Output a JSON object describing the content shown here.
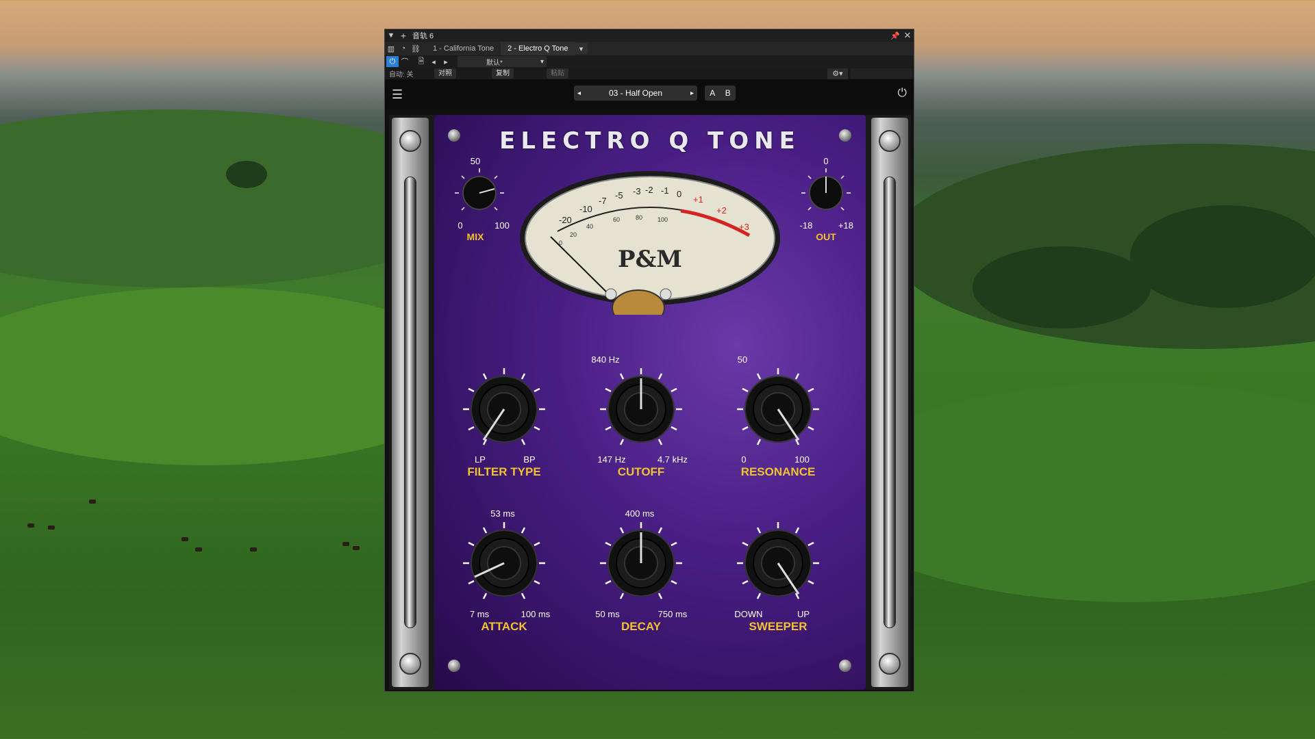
{
  "window": {
    "title": "音轨 6",
    "tabs": [
      "1 - California Tone",
      "2 - Electro Q Tone"
    ],
    "active_tab": 1,
    "preset_default": "默认*",
    "auto_label": "自动: 关",
    "compare_label": "对照",
    "copy_label": "复制",
    "paste_label": "粘贴"
  },
  "plugin_header": {
    "preset_name": "03 - Half Open",
    "a_label": "A",
    "b_label": "B"
  },
  "plugin": {
    "title": "ELECTRO Q TONE",
    "brand": "P&M",
    "mix": {
      "label": "MIX",
      "top": "50",
      "min": "0",
      "max": "100"
    },
    "out": {
      "label": "OUT",
      "top": "0",
      "min": "-18",
      "max": "+18"
    },
    "meter_scale": [
      "-20",
      "-10",
      "-7",
      "-5",
      "-3",
      "-2",
      "-1",
      "0",
      "+1",
      "+2",
      "+3"
    ],
    "meter_inner": [
      "0",
      "20",
      "40",
      "60",
      "80",
      "100"
    ],
    "filter_type": {
      "label": "FILTER TYPE",
      "min": "LP",
      "max": "BP"
    },
    "cutoff": {
      "label": "CUTOFF",
      "top": "840 Hz",
      "min": "147 Hz",
      "max": "4.7 kHz"
    },
    "resonance": {
      "label": "RESONANCE",
      "top": "50",
      "min": "0",
      "max": "100"
    },
    "attack": {
      "label": "ATTACK",
      "top": "53 ms",
      "min": "7 ms",
      "max": "100 ms"
    },
    "decay": {
      "label": "DECAY",
      "top": "400 ms",
      "min": "50 ms",
      "max": "750 ms"
    },
    "sweeper": {
      "label": "SWEEPER",
      "min": "DOWN",
      "max": "UP"
    }
  },
  "colors": {
    "accent": "#2a7fd4",
    "label_yellow": "#f2c230",
    "panel_purple": "#4a1f86"
  }
}
